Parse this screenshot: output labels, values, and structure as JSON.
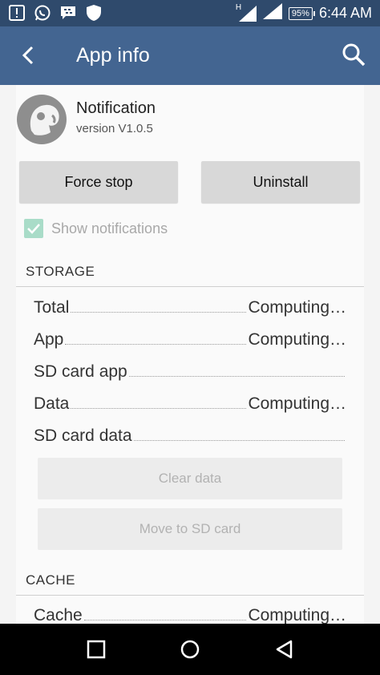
{
  "status_bar": {
    "notification_icons": [
      "message-icon",
      "whatsapp-icon",
      "bbm-icon",
      "shield-icon"
    ],
    "network_label": "H",
    "battery": "95%",
    "time": "6:44 AM"
  },
  "app_bar": {
    "title": "App info",
    "back_icon": "back-arrow-icon",
    "search_icon": "search-icon",
    "color": "#436591"
  },
  "app": {
    "name": "Notification",
    "version": "version V1.0.5"
  },
  "buttons": {
    "force_stop": "Force stop",
    "uninstall": "Uninstall"
  },
  "show_notifications": {
    "label": "Show notifications",
    "checked": true
  },
  "storage": {
    "header": "STORAGE",
    "rows": [
      {
        "label": "Total",
        "value": "Computing…"
      },
      {
        "label": "App",
        "value": "Computing…"
      },
      {
        "label": "SD card app",
        "value": ""
      },
      {
        "label": "Data",
        "value": "Computing…"
      },
      {
        "label": "SD card data",
        "value": ""
      }
    ],
    "clear_data": "Clear data",
    "move_to_sd": "Move to SD card"
  },
  "cache": {
    "header": "CACHE",
    "rows": [
      {
        "label": "Cache",
        "value": "Computing…"
      }
    ]
  },
  "nav_bar": {
    "icons": [
      "recents-icon",
      "home-icon",
      "back-icon"
    ]
  }
}
